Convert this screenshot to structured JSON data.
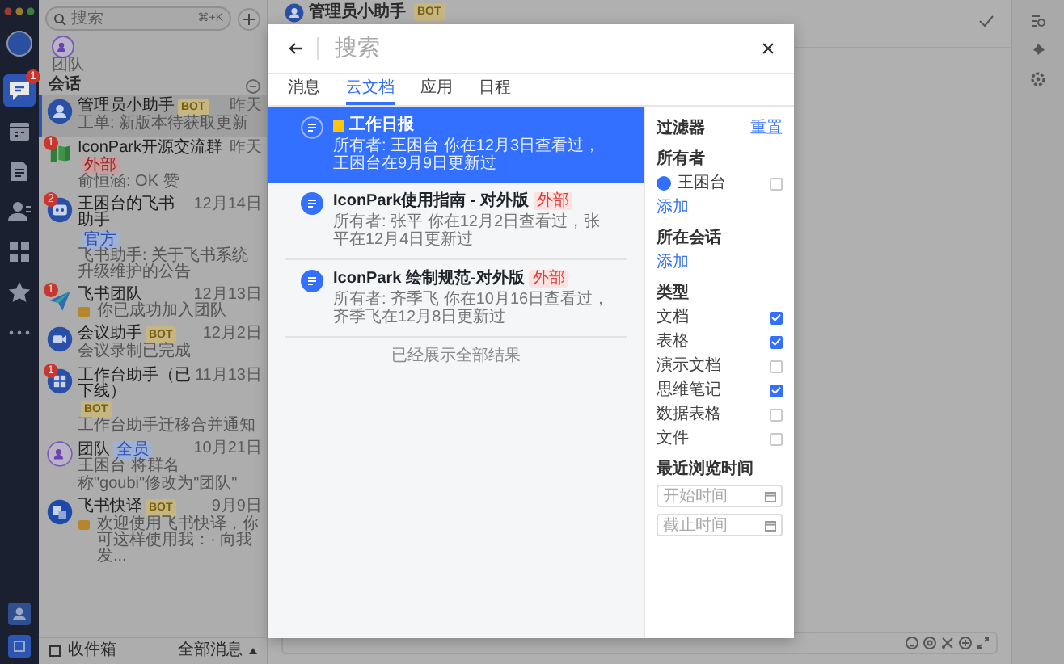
{
  "left_rail": {
    "items": [
      {
        "kind": "chat",
        "selected": true,
        "badge": "1"
      },
      {
        "kind": "calendar",
        "selected": false
      },
      {
        "kind": "docs",
        "selected": false
      },
      {
        "kind": "contacts",
        "selected": false
      },
      {
        "kind": "apps",
        "selected": false
      },
      {
        "kind": "star",
        "selected": false
      },
      {
        "kind": "more",
        "selected": false
      }
    ]
  },
  "chat_list": {
    "search": {
      "placeholder": "搜索",
      "shortcut": "⌘+K"
    },
    "team_shortcut": "团队",
    "section": "会话",
    "chats": [
      {
        "kind": "assistant",
        "name": "管理员小助手",
        "tag": {
          "text": "BOT",
          "kind": "bot"
        },
        "time": "昨天",
        "preview": "工单: 新版本待获取更新",
        "preview_icon": false,
        "selected": true
      },
      {
        "kind": "flag",
        "name": "IconPark开源交流群",
        "tag": {
          "text": "外部",
          "kind": "external"
        },
        "time": "昨天",
        "preview": "俞恒涵: OK 赞",
        "preview_icon": false,
        "badge": "1",
        "selected": false
      },
      {
        "kind": "robot",
        "name": "王困台的飞书助手",
        "tag": {
          "text": "官方",
          "kind": "official"
        },
        "time": "12月14日",
        "preview": "飞书助手: 关于飞书系统升级维护的公告",
        "preview_icon": false,
        "badge": "2",
        "selected": false
      },
      {
        "kind": "plane",
        "name": "飞书团队",
        "time": "12月13日",
        "preview": "你已成功加入团队",
        "preview_icon": true,
        "badge": "1",
        "selected": false
      },
      {
        "kind": "video",
        "name": "会议助手",
        "tag": {
          "text": "BOT",
          "kind": "bot"
        },
        "time": "12月2日",
        "preview": "会议录制已完成",
        "preview_icon": false,
        "selected": false
      },
      {
        "kind": "grid",
        "name": "工作台助手（已下线）",
        "tag": {
          "text": "BOT",
          "kind": "bot"
        },
        "time": "11月13日",
        "preview": "工作台助手迁移合并通知",
        "preview_icon": false,
        "badge": "1",
        "selected": false
      },
      {
        "kind": "team",
        "name": "团队",
        "tag": {
          "text": "全员",
          "kind": "official"
        },
        "time": "10月21日",
        "preview": "王困台 将群名称\"goubi\"修改为\"团队\"",
        "preview_icon": false,
        "selected": false
      },
      {
        "kind": "translate",
        "name": "飞书快译",
        "tag": {
          "text": "BOT",
          "kind": "bot"
        },
        "time": "9月9日",
        "preview": "欢迎使用飞书快译，你可这样使用我：· 向我发...",
        "preview_icon": true,
        "selected": false
      }
    ],
    "footer": {
      "inbox": "收件箱",
      "filter": "全部消息"
    }
  },
  "main": {
    "title": "管理员小助手",
    "tag": "BOT"
  },
  "search_modal": {
    "placeholder": "搜索",
    "tabs": [
      {
        "label": "消息",
        "selected": false
      },
      {
        "label": "云文档",
        "selected": true
      },
      {
        "label": "应用",
        "selected": false
      },
      {
        "label": "日程",
        "selected": false
      }
    ],
    "results": [
      {
        "title": "工作日报",
        "flag": true,
        "meta": "所有者: 王困台  你在12月3日查看过，王困台在9月9日更新过",
        "selected": true
      },
      {
        "title": "IconPark使用指南 - 对外版",
        "tag": "外部",
        "flag": false,
        "meta": "所有者: 张平  你在12月2日查看过，张平在12月4日更新过",
        "selected": false
      },
      {
        "title": "IconPark 绘制规范-对外版",
        "tag": "外部",
        "flag": false,
        "meta": "所有者: 齐季飞  你在10月16日查看过，齐季飞在12月8日更新过",
        "selected": false
      }
    ],
    "end_note": "已经展示全部结果",
    "filter": {
      "title": "过滤器",
      "reset": "重置",
      "owner_label": "所有者",
      "owners": [
        {
          "name": "王困台",
          "checked": false
        }
      ],
      "owner_add": "添加",
      "chat_label": "所在会话",
      "chat_add": "添加",
      "type_label": "类型",
      "types": [
        {
          "label": "文档",
          "checked": true
        },
        {
          "label": "表格",
          "checked": true
        },
        {
          "label": "演示文档",
          "checked": false
        },
        {
          "label": "思维笔记",
          "checked": true
        },
        {
          "label": "数据表格",
          "checked": false
        },
        {
          "label": "文件",
          "checked": false
        }
      ],
      "time_label": "最近浏览时间",
      "time_fields": [
        {
          "placeholder": "开始时间"
        },
        {
          "placeholder": "截止时间"
        }
      ]
    }
  }
}
